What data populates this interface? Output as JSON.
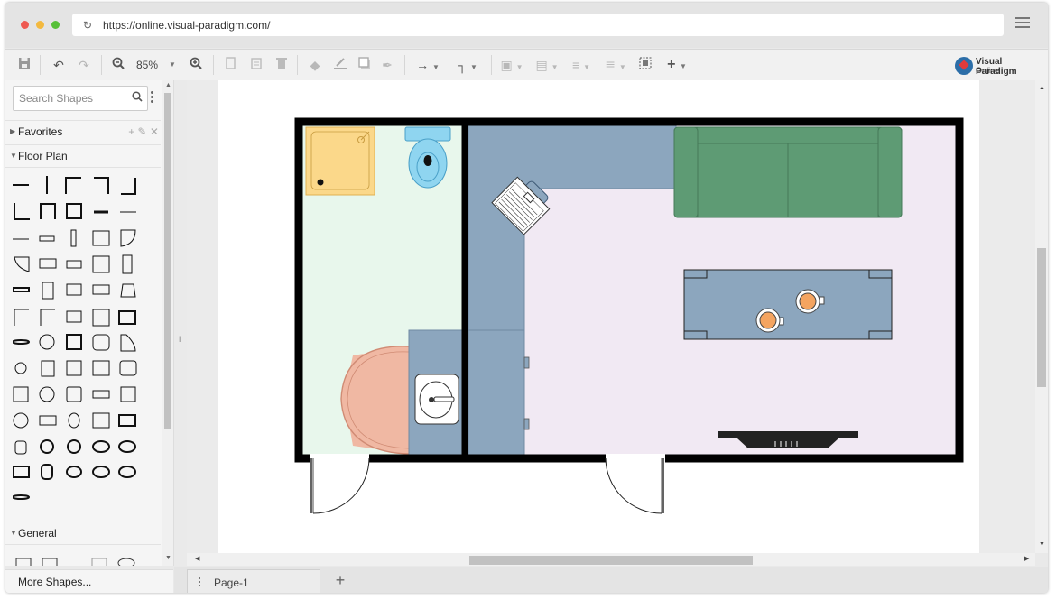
{
  "browser": {
    "url": "https://online.visual-paradigm.com/",
    "dot_colors": [
      "#ee5a52",
      "#f3b93f",
      "#57c038"
    ]
  },
  "toolbar": {
    "zoom_level": "85%",
    "buttons": [
      "save-icon",
      "undo-icon",
      "redo-icon",
      "zoom-out-icon",
      "zoom-in-icon",
      "copy-icon",
      "paste-icon",
      "delete-icon",
      "fill-icon",
      "line-color-icon",
      "shadow-icon",
      "format-painter-icon",
      "connector-icon",
      "waypoint-icon",
      "to-front-icon",
      "to-back-icon",
      "align-icon",
      "distribute-icon",
      "group-icon",
      "add-icon"
    ]
  },
  "brand": {
    "line1": "Visual Paradigm",
    "line2": "Online"
  },
  "sidebar": {
    "search_placeholder": "Search Shapes",
    "sections": [
      {
        "label": "Favorites",
        "expanded": false
      },
      {
        "label": "Floor Plan",
        "expanded": true
      },
      {
        "label": "General",
        "expanded": true
      }
    ],
    "more_shapes": "More Shapes..."
  },
  "bottom": {
    "page_tab": "Page-1"
  },
  "diagram": {
    "colors": {
      "bathroom_floor": "#e8f7ec",
      "room_floor": "#f1e9f3",
      "desk": "#8ca6be",
      "shower": "#fbd88a",
      "toilet": "#8fd5f0",
      "sofa": "#5e9b74",
      "rug": "#f0b8a3",
      "cup": "#f4a460"
    }
  }
}
